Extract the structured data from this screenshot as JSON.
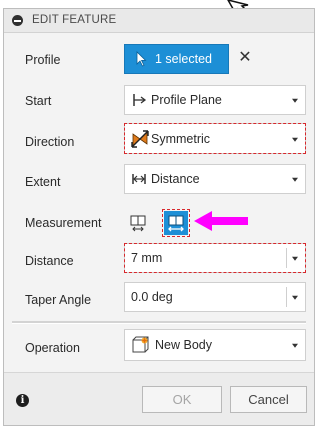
{
  "dialog": {
    "title": "EDIT FEATURE",
    "rows": {
      "profile": {
        "label": "Profile",
        "value": "1 selected"
      },
      "start": {
        "label": "Start",
        "value": "Profile Plane"
      },
      "direction": {
        "label": "Direction",
        "value": "Symmetric"
      },
      "extent": {
        "label": "Extent",
        "value": "Distance"
      },
      "measurement": {
        "label": "Measurement"
      },
      "distance": {
        "label": "Distance",
        "value": "7 mm"
      },
      "taper": {
        "label": "Taper Angle",
        "value": "0.0 deg"
      },
      "operation": {
        "label": "Operation",
        "value": "New Body"
      }
    },
    "buttons": {
      "ok": "OK",
      "cancel": "Cancel",
      "clear": "✕"
    }
  },
  "colors": {
    "accent": "#1d8fd6",
    "highlight": "#d8282c",
    "pointer_arrow": "#ff00ff"
  },
  "icons": [
    "collapse-icon",
    "cursor-arrow-icon",
    "select-arrow-icon",
    "profile-plane-icon",
    "symmetric-icon",
    "distance-icon",
    "measurement-half-icon",
    "measurement-whole-icon",
    "new-body-icon",
    "info-icon"
  ]
}
